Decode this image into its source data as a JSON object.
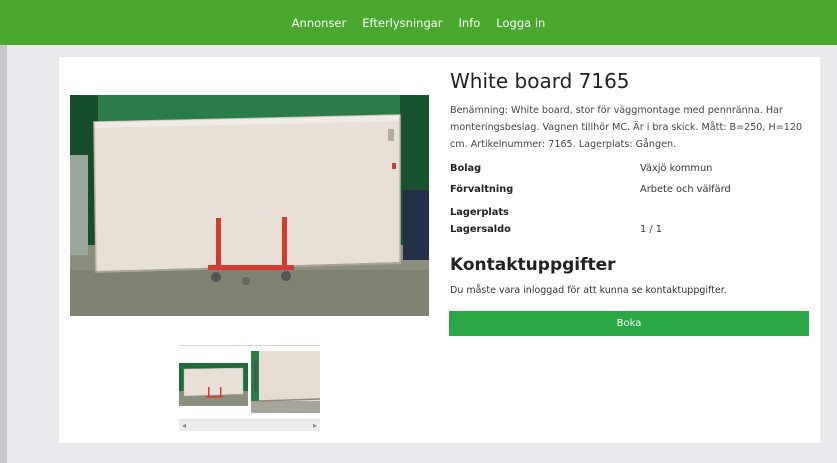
{
  "nav": {
    "items": [
      "Annonser",
      "Efterlysningar",
      "Info",
      "Logga in"
    ]
  },
  "product": {
    "title": "White board 7165",
    "description": "Benämning: White board, stor för väggmontage med pennränna. Har monteringsbeslag. Vagnen tillhör MC. Är i bra skick. Mått: B=250, H=120 cm. Artikelnummer: 7165. Lagerplats: Gången.",
    "props": [
      {
        "label": "Bolag",
        "value": "Växjö kommun"
      },
      {
        "label": "Förvaltning",
        "value": "Arbete och välfärd"
      },
      {
        "label": "Lagerplats",
        "value": ""
      },
      {
        "label": "Lagersaldo",
        "value": "1 / 1"
      }
    ]
  },
  "contact": {
    "title": "Kontaktuppgifter",
    "text": "Du måste vara inloggad för att kunna se kontaktuppgifter."
  },
  "actions": {
    "book_label": "Boka"
  },
  "colors": {
    "nav_bg": "#49a82e",
    "button_bg": "#28a744",
    "page_bg": "#e9e8ec"
  }
}
